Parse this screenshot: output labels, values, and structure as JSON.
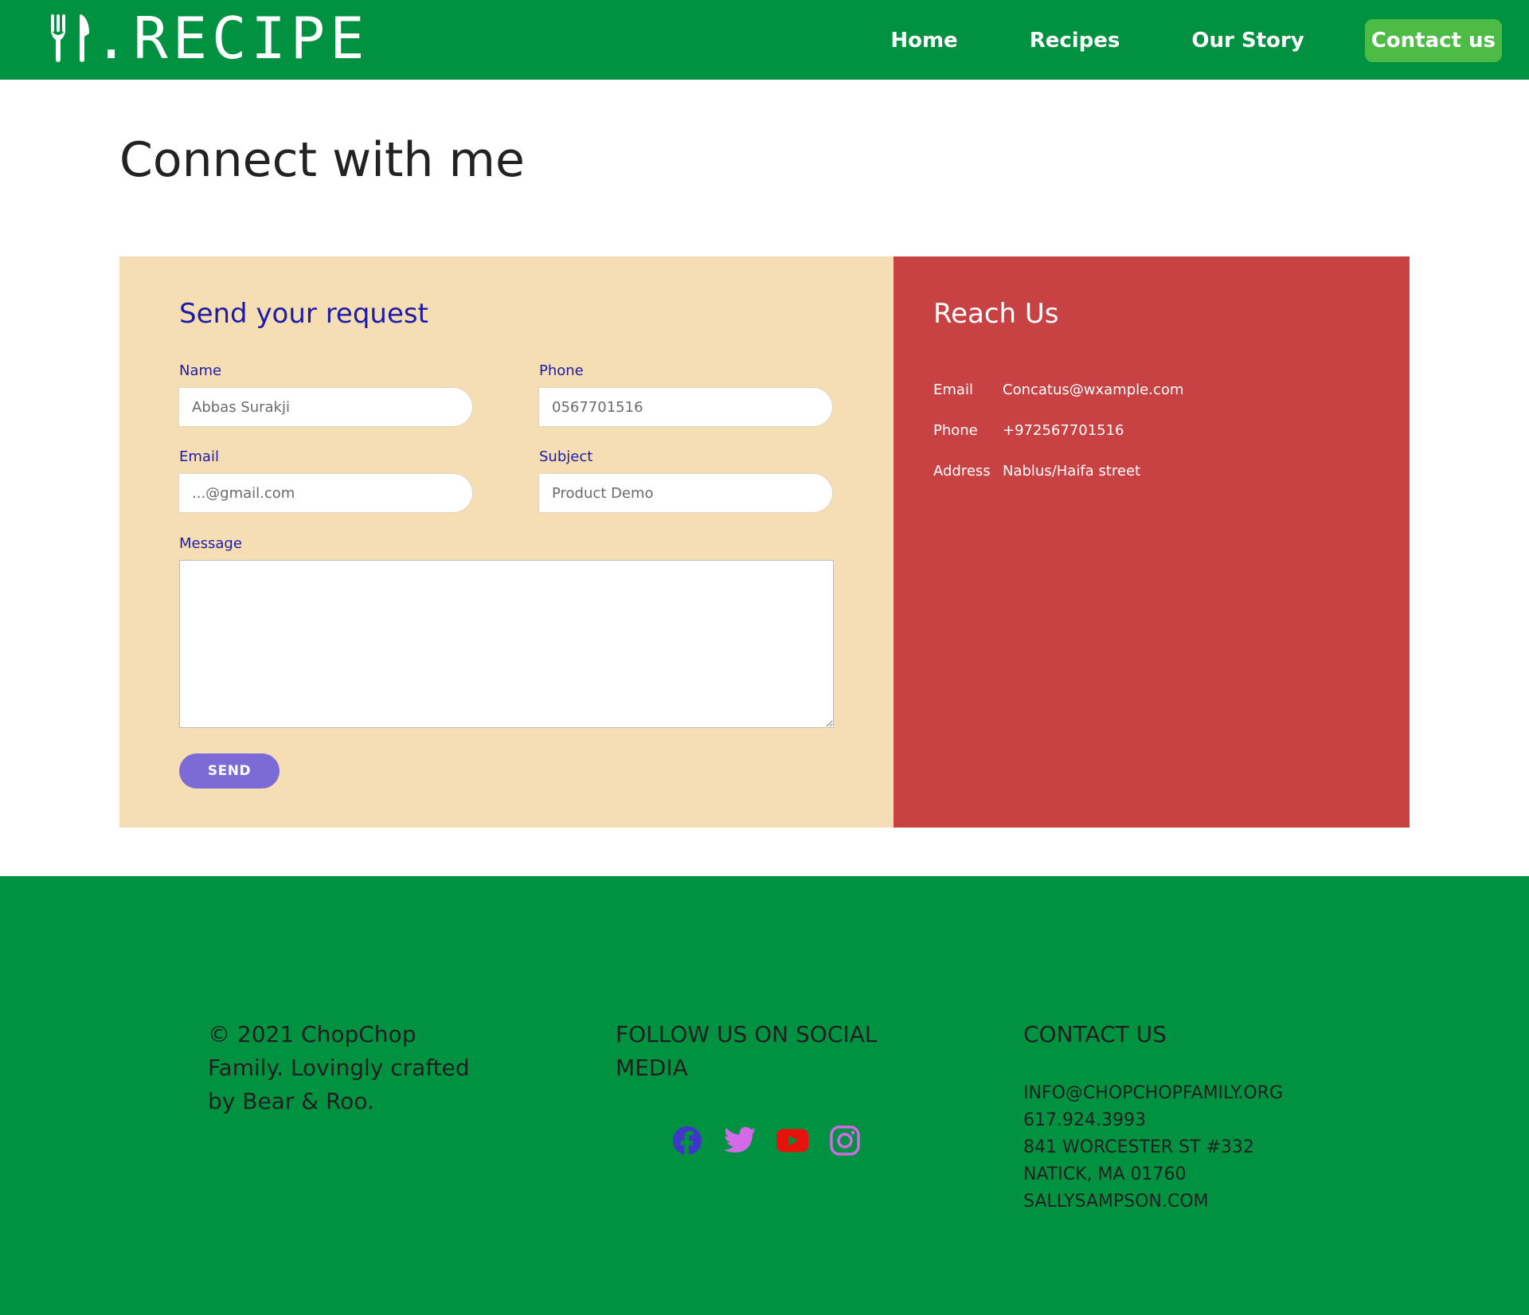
{
  "header": {
    "logo_text": ".RECIPE",
    "nav": [
      {
        "label": "Home"
      },
      {
        "label": "Recipes"
      },
      {
        "label": "Our Story"
      },
      {
        "label": "Contact us",
        "active": true
      }
    ],
    "colors": {
      "background": "#009241",
      "active_nav": "#4dbc46"
    }
  },
  "main": {
    "title": "Connect with me",
    "form": {
      "title": "Send your request",
      "name_label": "Name",
      "name_placeholder": "Abbas Surakji",
      "phone_label": "Phone",
      "phone_placeholder": "0567701516",
      "email_label": "Email",
      "email_placeholder": "...@gmail.com",
      "subject_label": "Subject",
      "subject_placeholder": "Product Demo",
      "message_label": "Message",
      "message_value": "",
      "send_label": "SEND",
      "colors": {
        "panel": "#f5deb3",
        "label": "#1e1ba8",
        "button": "#7c6bd6"
      }
    },
    "reach": {
      "title": "Reach Us",
      "rows": [
        {
          "key": "Email",
          "value": "Concatus@wxample.com"
        },
        {
          "key": "Phone",
          "value": "+972567701516"
        },
        {
          "key": "Address",
          "value": "Nablus/Haifa street"
        }
      ],
      "colors": {
        "panel": "#c94243"
      }
    }
  },
  "footer": {
    "copyright": "© 2021 ChopChop Family. Lovingly crafted by Bear & Roo.",
    "social_title": "FOLLOW US ON SOCIAL MEDIA",
    "social_icons": [
      "facebook-icon",
      "twitter-icon",
      "youtube-icon",
      "instagram-icon"
    ],
    "contact_title": "CONTACT US",
    "contact_lines": [
      "INFO@CHOPCHOPFAMILY.ORG",
      "617.924.3993",
      "841 WORCESTER ST #332",
      "NATICK, MA 01760",
      "SALLYSAMPSON.COM"
    ],
    "colors": {
      "background": "#009241"
    }
  }
}
